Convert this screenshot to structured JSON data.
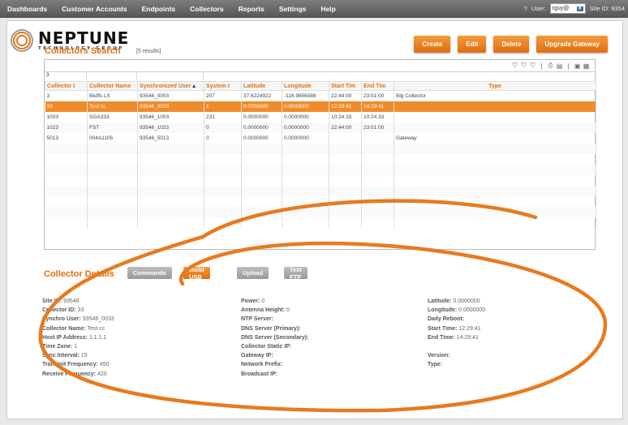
{
  "nav": {
    "items": [
      "Dashboards",
      "Customer Accounts",
      "Endpoints",
      "Collectors",
      "Reports",
      "Settings",
      "Help"
    ],
    "help_icon": "?",
    "user_label": "User:",
    "user_value": "rguy@",
    "site_label": "Site ID: 9354"
  },
  "logo": {
    "name": "NEPTUNE",
    "tagline": "TECHNOLOGY GROUP"
  },
  "actions": {
    "create": "Create",
    "edit": "Edit",
    "delete": "Delete",
    "upgrade": "Upgrade Gateway"
  },
  "search": {
    "title": "Collectors Search",
    "results": "[5 results]",
    "filter_value": "3"
  },
  "table": {
    "columns": [
      "Collector I",
      "Collector Name",
      "Synchronized User",
      "System I",
      "Latitude",
      "Longitude",
      "Start Tim",
      "End Tim",
      "Type"
    ],
    "rows": [
      [
        "3",
        "Bluffs LS",
        "93546_0003",
        "207",
        "37.6224922",
        "-116.9856988",
        "22:44:00",
        "23:01:00",
        "Big Collector"
      ],
      [
        "33",
        "Test cc",
        "93546_0033",
        "1",
        "0.0000000",
        "0.0000000",
        "12:29:41",
        "14:29:41",
        ""
      ],
      [
        "1003",
        "SGA333",
        "93546_1003",
        "231",
        "0.0000000",
        "0.0000000",
        "10:24:33",
        "10:24:33",
        ""
      ],
      [
        "1023",
        "FST",
        "93546_1023",
        "0",
        "0.0000000",
        "0.0000000",
        "22:44:00",
        "23:01:00",
        ""
      ],
      [
        "5013",
        "004A1105",
        "93546_5013",
        "0",
        "0.0000000",
        "0.0000000",
        "",
        "",
        "Gateway"
      ]
    ],
    "selected_row": 1
  },
  "details": {
    "title": "Collector Details",
    "tabs": {
      "commands": "Commands",
      "build_usb": "Build USB",
      "upload": "Upload",
      "test_ftp": "Test FTP"
    },
    "col1": [
      {
        "label": "Site ID:",
        "value": "93546"
      },
      {
        "label": "Collector ID:",
        "value": "33"
      },
      {
        "label": "Synchro User:",
        "value": "93546_0033"
      },
      {
        "label": "Collector Name:",
        "value": "Test cc"
      },
      {
        "label": "Host IP Address:",
        "value": "1.1.1.1"
      },
      {
        "label": "Time Zone:",
        "value": "1"
      },
      {
        "label": "Sync Interval:",
        "value": "15"
      },
      {
        "label": "Transmit Frequency:",
        "value": "450"
      },
      {
        "label": "Receive Frequency:",
        "value": "420"
      }
    ],
    "col2": [
      {
        "label": "Power:",
        "value": "0"
      },
      {
        "label": "Antenna Height:",
        "value": "0"
      },
      {
        "label": "NTP Server:",
        "value": ""
      },
      {
        "label": "DNS Server (Primary):",
        "value": ""
      },
      {
        "label": "DNS Server (Secondary):",
        "value": ""
      },
      {
        "label": "Collector Static IP:",
        "value": ""
      },
      {
        "label": "Gateway IP:",
        "value": ""
      },
      {
        "label": "Network Prefix:",
        "value": ""
      },
      {
        "label": "Broadcast IP:",
        "value": ""
      }
    ],
    "col3": [
      {
        "label": "Latitude:",
        "value": "0.0000000"
      },
      {
        "label": "Longitude:",
        "value": "0.0000000"
      },
      {
        "label": "Daily Reboot:",
        "value": ""
      },
      {
        "label": "Start Time:",
        "value": "12:29:41"
      },
      {
        "label": "End Time:",
        "value": "14:29:41"
      },
      {
        "label": "",
        "value": ""
      },
      {
        "label": "Version:",
        "value": ""
      },
      {
        "label": "Type:",
        "value": ""
      }
    ]
  },
  "colors": {
    "accent": "#e06f10",
    "selected_row": "#f08b2a",
    "nav_bg": "#666666"
  }
}
